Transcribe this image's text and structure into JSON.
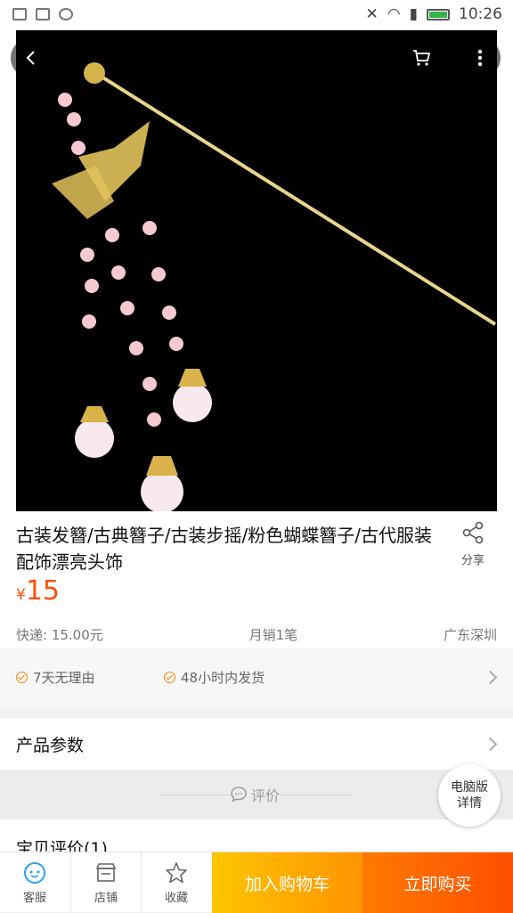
{
  "status_bar": {
    "time": "10:26"
  },
  "product": {
    "title": "古装发簪/古典簪子/古装步摇/粉色蝴蝶簪子/古代服装配饰漂亮头饰",
    "currency": "¥",
    "price": "15",
    "share_label": "分享",
    "shipping": "快递: 15.00元",
    "monthly_sales": "月销1笔",
    "location": "广东深圳"
  },
  "services": [
    {
      "label": "7天无理由"
    },
    {
      "label": "48小时内发货"
    }
  ],
  "params_label": "产品参数",
  "review_divider_label": "评价",
  "pc_version": {
    "line1": "电脑版",
    "line2": "详情"
  },
  "reviews_label": "宝贝评价(1)",
  "bottom_bar": {
    "service": "客服",
    "shop": "店铺",
    "favorite": "收藏",
    "add_to_cart": "加入购物车",
    "buy_now": "立即购买"
  },
  "colors": {
    "price": "#ff5000",
    "add_to_cart": "#ffb300",
    "buy_now": "#ff5a00"
  }
}
